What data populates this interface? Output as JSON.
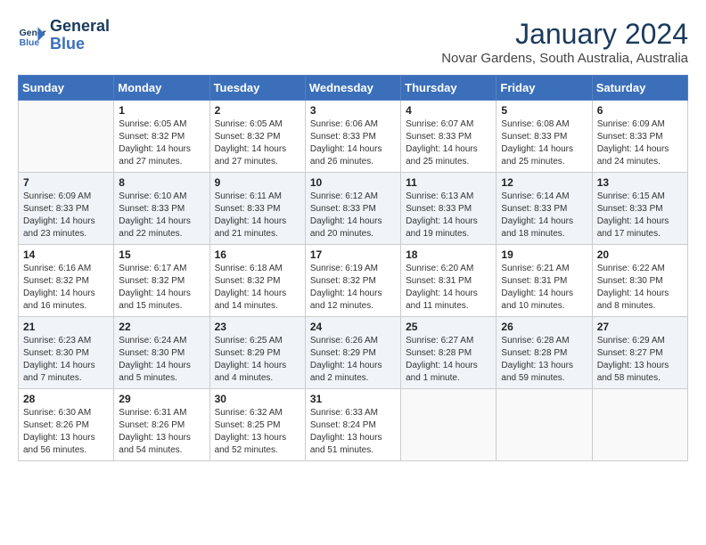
{
  "logo": {
    "line1": "General",
    "line2": "Blue"
  },
  "title": "January 2024",
  "subtitle": "Novar Gardens, South Australia, Australia",
  "days": [
    "Sunday",
    "Monday",
    "Tuesday",
    "Wednesday",
    "Thursday",
    "Friday",
    "Saturday"
  ],
  "weeks": [
    [
      {
        "num": "",
        "info": ""
      },
      {
        "num": "1",
        "info": "Sunrise: 6:05 AM\nSunset: 8:32 PM\nDaylight: 14 hours\nand 27 minutes."
      },
      {
        "num": "2",
        "info": "Sunrise: 6:05 AM\nSunset: 8:32 PM\nDaylight: 14 hours\nand 27 minutes."
      },
      {
        "num": "3",
        "info": "Sunrise: 6:06 AM\nSunset: 8:33 PM\nDaylight: 14 hours\nand 26 minutes."
      },
      {
        "num": "4",
        "info": "Sunrise: 6:07 AM\nSunset: 8:33 PM\nDaylight: 14 hours\nand 25 minutes."
      },
      {
        "num": "5",
        "info": "Sunrise: 6:08 AM\nSunset: 8:33 PM\nDaylight: 14 hours\nand 25 minutes."
      },
      {
        "num": "6",
        "info": "Sunrise: 6:09 AM\nSunset: 8:33 PM\nDaylight: 14 hours\nand 24 minutes."
      }
    ],
    [
      {
        "num": "7",
        "info": "Sunrise: 6:09 AM\nSunset: 8:33 PM\nDaylight: 14 hours\nand 23 minutes."
      },
      {
        "num": "8",
        "info": "Sunrise: 6:10 AM\nSunset: 8:33 PM\nDaylight: 14 hours\nand 22 minutes."
      },
      {
        "num": "9",
        "info": "Sunrise: 6:11 AM\nSunset: 8:33 PM\nDaylight: 14 hours\nand 21 minutes."
      },
      {
        "num": "10",
        "info": "Sunrise: 6:12 AM\nSunset: 8:33 PM\nDaylight: 14 hours\nand 20 minutes."
      },
      {
        "num": "11",
        "info": "Sunrise: 6:13 AM\nSunset: 8:33 PM\nDaylight: 14 hours\nand 19 minutes."
      },
      {
        "num": "12",
        "info": "Sunrise: 6:14 AM\nSunset: 8:33 PM\nDaylight: 14 hours\nand 18 minutes."
      },
      {
        "num": "13",
        "info": "Sunrise: 6:15 AM\nSunset: 8:33 PM\nDaylight: 14 hours\nand 17 minutes."
      }
    ],
    [
      {
        "num": "14",
        "info": "Sunrise: 6:16 AM\nSunset: 8:32 PM\nDaylight: 14 hours\nand 16 minutes."
      },
      {
        "num": "15",
        "info": "Sunrise: 6:17 AM\nSunset: 8:32 PM\nDaylight: 14 hours\nand 15 minutes."
      },
      {
        "num": "16",
        "info": "Sunrise: 6:18 AM\nSunset: 8:32 PM\nDaylight: 14 hours\nand 14 minutes."
      },
      {
        "num": "17",
        "info": "Sunrise: 6:19 AM\nSunset: 8:32 PM\nDaylight: 14 hours\nand 12 minutes."
      },
      {
        "num": "18",
        "info": "Sunrise: 6:20 AM\nSunset: 8:31 PM\nDaylight: 14 hours\nand 11 minutes."
      },
      {
        "num": "19",
        "info": "Sunrise: 6:21 AM\nSunset: 8:31 PM\nDaylight: 14 hours\nand 10 minutes."
      },
      {
        "num": "20",
        "info": "Sunrise: 6:22 AM\nSunset: 8:30 PM\nDaylight: 14 hours\nand 8 minutes."
      }
    ],
    [
      {
        "num": "21",
        "info": "Sunrise: 6:23 AM\nSunset: 8:30 PM\nDaylight: 14 hours\nand 7 minutes."
      },
      {
        "num": "22",
        "info": "Sunrise: 6:24 AM\nSunset: 8:30 PM\nDaylight: 14 hours\nand 5 minutes."
      },
      {
        "num": "23",
        "info": "Sunrise: 6:25 AM\nSunset: 8:29 PM\nDaylight: 14 hours\nand 4 minutes."
      },
      {
        "num": "24",
        "info": "Sunrise: 6:26 AM\nSunset: 8:29 PM\nDaylight: 14 hours\nand 2 minutes."
      },
      {
        "num": "25",
        "info": "Sunrise: 6:27 AM\nSunset: 8:28 PM\nDaylight: 14 hours\nand 1 minute."
      },
      {
        "num": "26",
        "info": "Sunrise: 6:28 AM\nSunset: 8:28 PM\nDaylight: 13 hours\nand 59 minutes."
      },
      {
        "num": "27",
        "info": "Sunrise: 6:29 AM\nSunset: 8:27 PM\nDaylight: 13 hours\nand 58 minutes."
      }
    ],
    [
      {
        "num": "28",
        "info": "Sunrise: 6:30 AM\nSunset: 8:26 PM\nDaylight: 13 hours\nand 56 minutes."
      },
      {
        "num": "29",
        "info": "Sunrise: 6:31 AM\nSunset: 8:26 PM\nDaylight: 13 hours\nand 54 minutes."
      },
      {
        "num": "30",
        "info": "Sunrise: 6:32 AM\nSunset: 8:25 PM\nDaylight: 13 hours\nand 52 minutes."
      },
      {
        "num": "31",
        "info": "Sunrise: 6:33 AM\nSunset: 8:24 PM\nDaylight: 13 hours\nand 51 minutes."
      },
      {
        "num": "",
        "info": ""
      },
      {
        "num": "",
        "info": ""
      },
      {
        "num": "",
        "info": ""
      }
    ]
  ]
}
